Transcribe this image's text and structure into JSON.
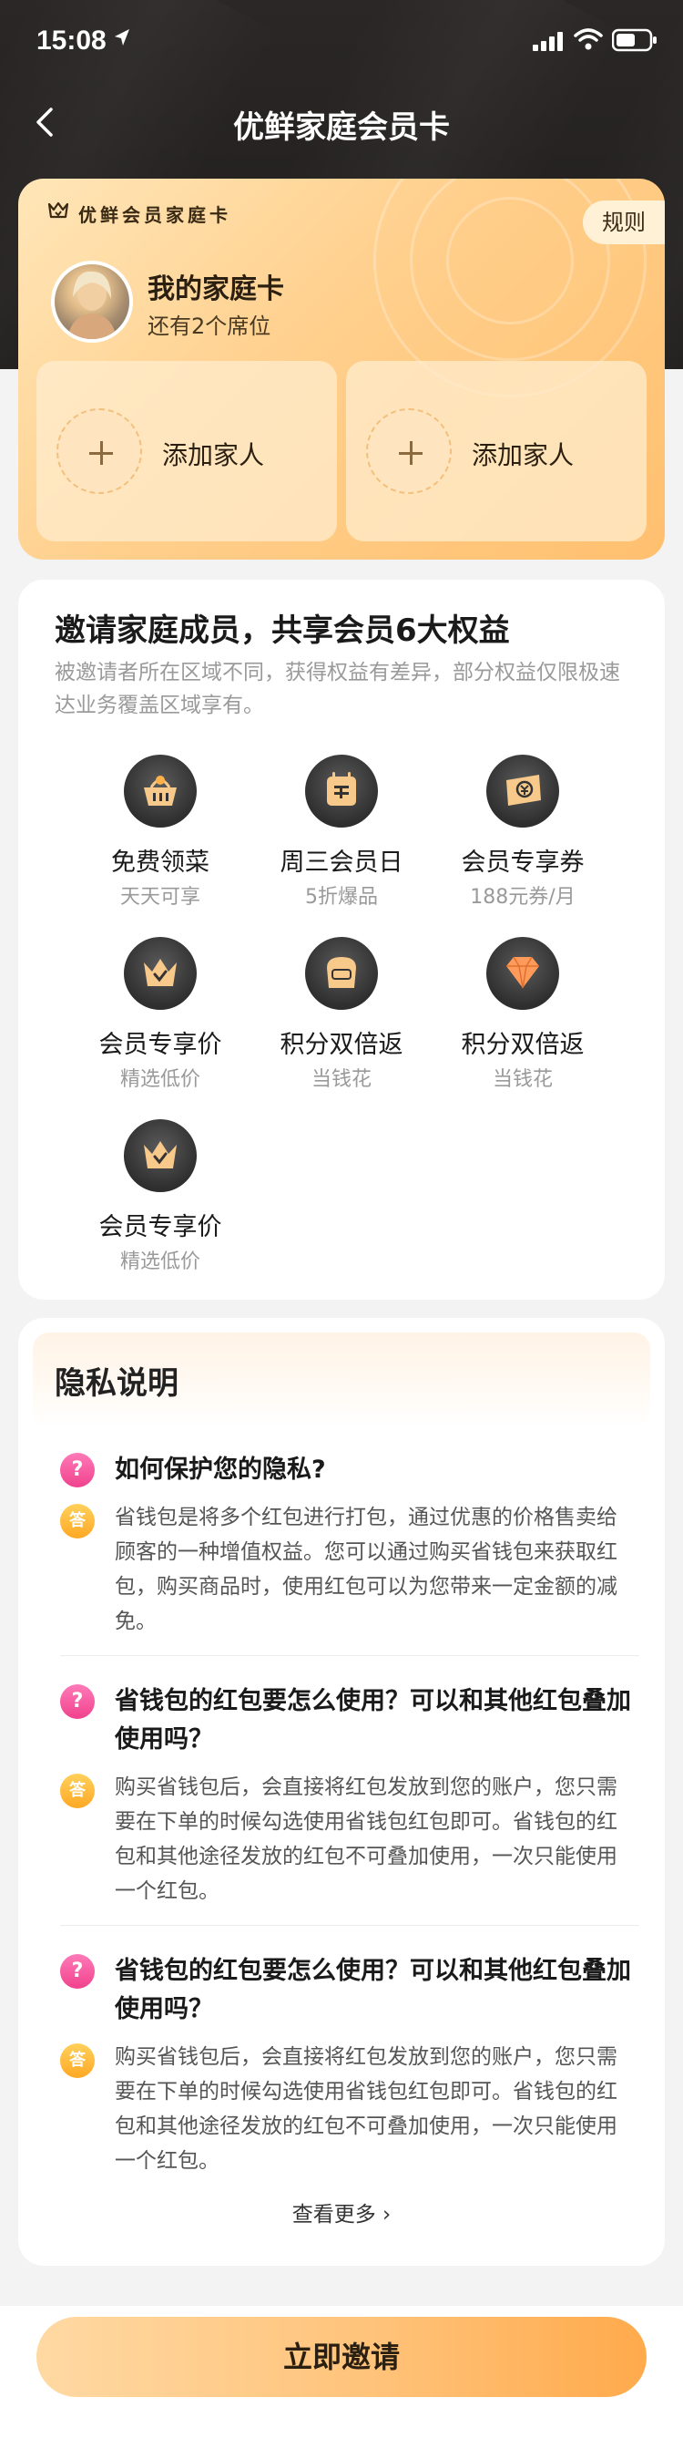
{
  "status_bar": {
    "time": "15:08"
  },
  "nav": {
    "title": "优鲜家庭会员卡"
  },
  "family_card": {
    "label": "优鲜会员家庭卡",
    "rules": "规则",
    "title": "我的家庭卡",
    "subtitle": "还有2个席位",
    "slots": [
      {
        "label": "添加家人"
      },
      {
        "label": "添加家人"
      }
    ]
  },
  "benefits": {
    "title": "邀请家庭成员，共享会员6大权益",
    "description": "被邀请者所在区域不同，获得权益有差异，部分权益仅限极速达业务覆盖区域享有。",
    "items": [
      {
        "name": "免费领菜",
        "sub": "天天可享",
        "icon": "basket-icon"
      },
      {
        "name": "周三会员日",
        "sub": "5折爆品",
        "icon": "calendar-icon"
      },
      {
        "name": "会员专享券",
        "sub": "188元券/月",
        "icon": "coupon-icon"
      },
      {
        "name": "会员专享价",
        "sub": "精选低价",
        "icon": "crown-icon"
      },
      {
        "name": "积分双倍返",
        "sub": "当钱花",
        "icon": "bread-icon"
      },
      {
        "name": "积分双倍返",
        "sub": "当钱花",
        "icon": "diamond-icon"
      },
      {
        "name": "会员专享价",
        "sub": "精选低价",
        "icon": "crown-icon"
      }
    ]
  },
  "privacy": {
    "title": "隐私说明",
    "q_badge": "?",
    "a_badge": "答",
    "qa": [
      {
        "q": "如何保护您的隐私?",
        "a": "省钱包是将多个红包进行打包，通过优惠的价格售卖给顾客的一种增值权益。您可以通过购买省钱包来获取红包，购买商品时，使用红包可以为您带来一定金额的减免。"
      },
      {
        "q": "省钱包的红包要怎么使用？可以和其他红包叠加使用吗？",
        "a": "购买省钱包后，会直接将红包发放到您的账户，您只需要在下单的时候勾选使用省钱包红包即可。省钱包的红包和其他途径发放的红包不可叠加使用，一次只能使用一个红包。"
      },
      {
        "q": "省钱包的红包要怎么使用？可以和其他红包叠加使用吗？",
        "a": "购买省钱包后，会直接将红包发放到您的账户，您只需要在下单的时候勾选使用省钱包红包即可。省钱包的红包和其他途径发放的红包不可叠加使用，一次只能使用一个红包。"
      }
    ],
    "see_more": "查看更多 ›"
  },
  "bottom": {
    "invite_label": "立即邀请"
  },
  "colors": {
    "header_bg": "#1f1d1c",
    "card_gold": "#ffc06f",
    "question_pink": "#f0428d",
    "answer_orange": "#ffa824",
    "invite_orange": "#ffaa4c"
  }
}
